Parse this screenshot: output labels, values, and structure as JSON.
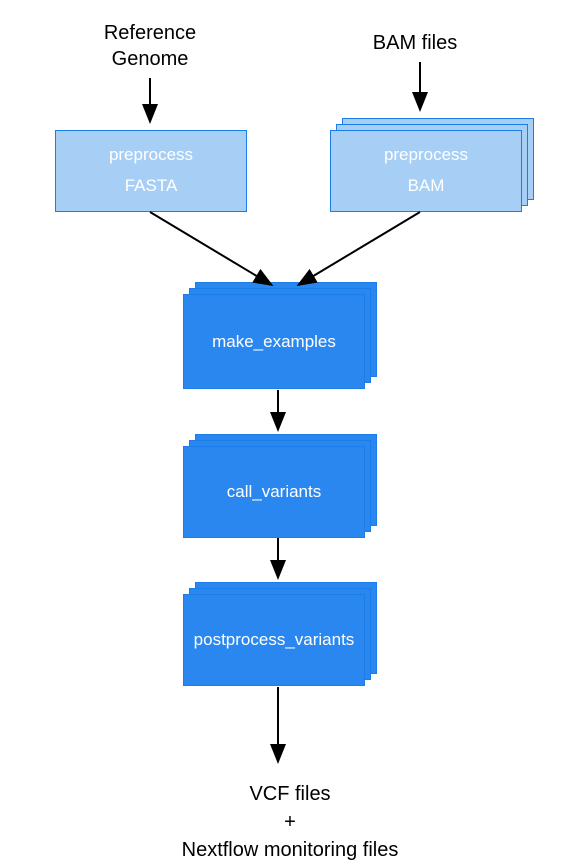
{
  "inputs": {
    "left_label_line1": "Reference",
    "left_label_line2": "Genome",
    "right_label": "BAM files"
  },
  "preprocess": {
    "left_line1": "preprocess",
    "left_line2": "FASTA",
    "right_line1": "preprocess",
    "right_line2": "BAM"
  },
  "steps": {
    "make_examples": "make_examples",
    "call_variants": "call_variants",
    "postprocess_variants": "postprocess_variants"
  },
  "output": {
    "line1": "VCF files",
    "line2": "+",
    "line3": "Nextflow monitoring files"
  }
}
